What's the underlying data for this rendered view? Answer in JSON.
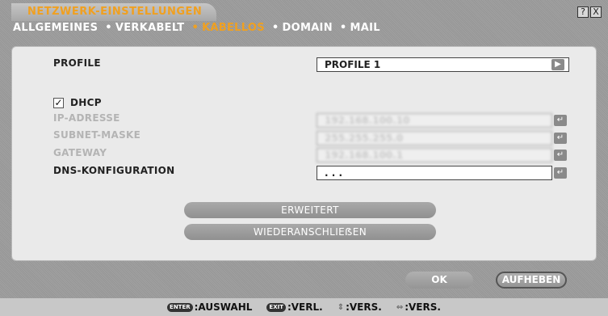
{
  "window": {
    "title": "NETZWERK-EINSTELLUNGEN",
    "help_icon": "?",
    "close_icon": "X"
  },
  "tabs": [
    {
      "label": "ALLGEMEINES",
      "active": false
    },
    {
      "label": "VERKABELT",
      "active": false
    },
    {
      "label": "KABELLOS",
      "active": true
    },
    {
      "label": "DOMAIN",
      "active": false
    },
    {
      "label": "MAIL",
      "active": false
    }
  ],
  "profile": {
    "label": "PROFILE",
    "value": "PROFILE 1",
    "arrow_icon": "triangle-right-icon"
  },
  "dhcp": {
    "label": "DHCP",
    "checked": true
  },
  "fields": [
    {
      "label": "IP-ADRESSE",
      "value": "192.168.100.10",
      "enabled": false
    },
    {
      "label": "SUBNET-MASKE",
      "value": "255.255.255.0",
      "enabled": false
    },
    {
      "label": "GATEWAY",
      "value": "192.168.100.1",
      "enabled": false
    },
    {
      "label": "DNS-KONFIGURATION",
      "value": ".   .   .",
      "enabled": true
    }
  ],
  "buttons": {
    "advanced": "ERWEITERT",
    "reconnect": "WIEDERANSCHLIEẞEN",
    "ok": "OK",
    "cancel": "AUFHEBEN"
  },
  "status_bar": [
    {
      "key": "ENTER",
      "text": ":AUSWAHL"
    },
    {
      "key": "EXIT",
      "text": ":VERL."
    },
    {
      "key": "updown-icon",
      "text": ":VERS."
    },
    {
      "key": "leftright-icon",
      "text": ":VERS."
    }
  ],
  "colors": {
    "accent": "#f0a020",
    "background": "#9c9c9c",
    "panel": "#eaeaea"
  }
}
